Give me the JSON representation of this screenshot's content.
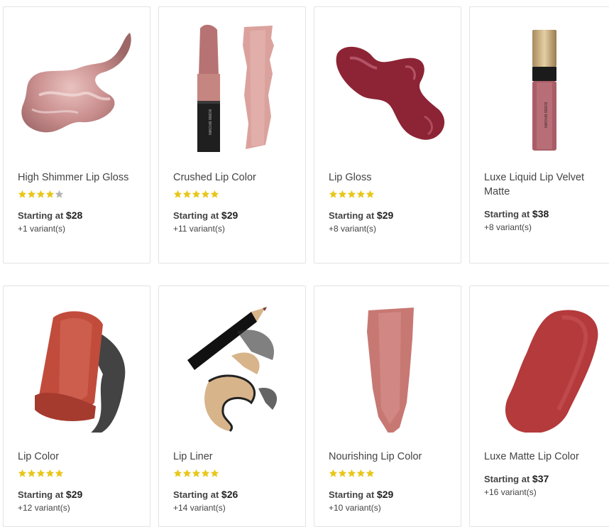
{
  "colors": {
    "star_filled": "#e8c61a",
    "star_empty": "#b3b3b3",
    "border": "#e3e3e3"
  },
  "products": [
    {
      "name": "High Shimmer Lip Gloss",
      "rating": 4,
      "price_label": "Starting at",
      "price": "$28",
      "variants": "+1 variant(s)",
      "image": "shimmer-gloss-swatch"
    },
    {
      "name": "Crushed Lip Color",
      "rating": 5,
      "price_label": "Starting at",
      "price": "$29",
      "variants": "+11 variant(s)",
      "image": "lipstick-with-swatch"
    },
    {
      "name": "Lip Gloss",
      "rating": 5,
      "price_label": "Starting at",
      "price": "$29",
      "variants": "+8 variant(s)",
      "image": "berry-gloss-swatch"
    },
    {
      "name": "Luxe Liquid Lip Velvet Matte",
      "rating": null,
      "price_label": "Starting at",
      "price": "$38",
      "variants": "+8 variant(s)",
      "image": "liquid-lip-bottle"
    },
    {
      "name": "Lip Color",
      "rating": 5,
      "price_label": "Starting at",
      "price": "$29",
      "variants": "+12 variant(s)",
      "image": "lipstick-bullet"
    },
    {
      "name": "Lip Liner",
      "rating": 5,
      "price_label": "Starting at",
      "price": "$26",
      "variants": "+14 variant(s)",
      "image": "pencil-shavings"
    },
    {
      "name": "Nourishing Lip Color",
      "rating": 5,
      "price_label": "Starting at",
      "price": "$29",
      "variants": "+10 variant(s)",
      "image": "nude-swatch"
    },
    {
      "name": "Luxe Matte Lip Color",
      "rating": null,
      "price_label": "Starting at",
      "price": "$37",
      "variants": "+16 variant(s)",
      "image": "red-matte-swatch"
    }
  ]
}
